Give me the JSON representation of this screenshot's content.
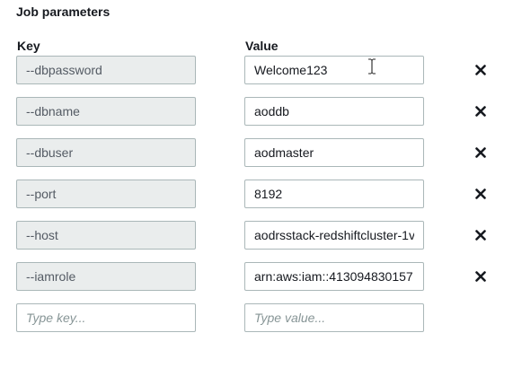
{
  "section": {
    "title": "Job parameters"
  },
  "columns": {
    "key": "Key",
    "value": "Value"
  },
  "parameters": [
    {
      "key": "--dbpassword",
      "value": "Welcome123"
    },
    {
      "key": "--dbname",
      "value": "aoddb"
    },
    {
      "key": "--dbuser",
      "value": "aodmaster"
    },
    {
      "key": "--port",
      "value": "8192"
    },
    {
      "key": "--host",
      "value": "aodrsstack-redshiftcluster-1v"
    },
    {
      "key": "--iamrole",
      "value": "arn:aws:iam::413094830157"
    }
  ],
  "new_row": {
    "key_placeholder": "Type key...",
    "value_placeholder": "Type value..."
  },
  "icons": {
    "remove": "close-x-icon",
    "cursor": "text-cursor-icon"
  }
}
